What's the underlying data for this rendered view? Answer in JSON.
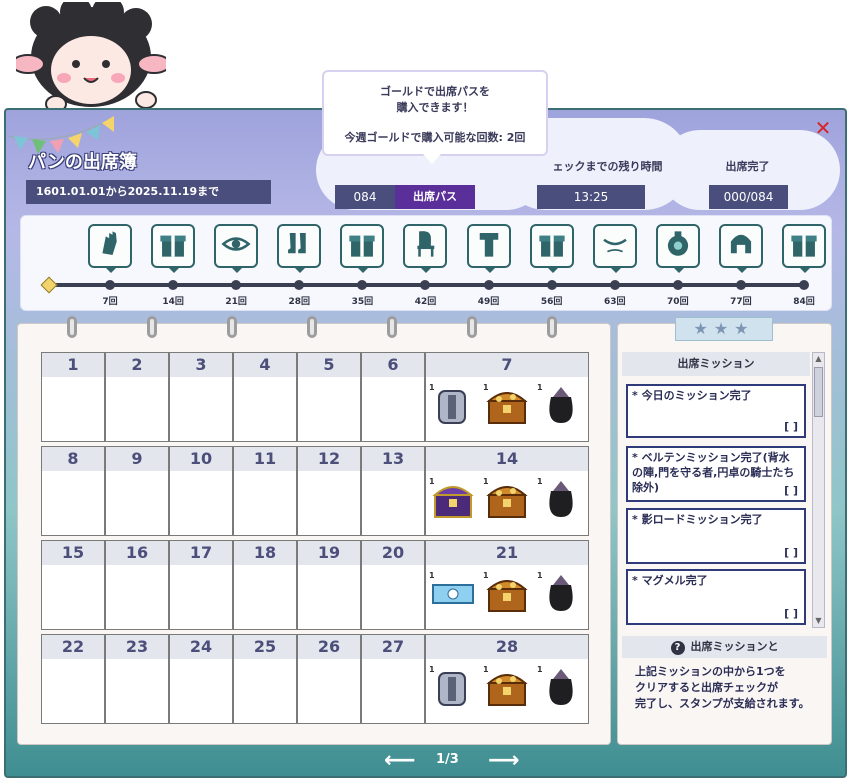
{
  "window": {
    "title": "パンの出席簿",
    "date_range": "1601.01.01から2025.11.19まで"
  },
  "tooltip": {
    "line1": "ゴールドで出席パスを",
    "line2": "購入できます！",
    "line3": "今週ゴールドで購入可能な回数: 2回"
  },
  "pass": {
    "count": "084",
    "button_label": "出席パス"
  },
  "remaining": {
    "label": "ェックまでの残り時間",
    "value": "13:25"
  },
  "completion": {
    "label": "出席完了",
    "value": "000/084"
  },
  "track": {
    "rewards": [
      "glove-icon",
      "gift-box-icon",
      "eye-icon",
      "boots-icon",
      "gift-box-icon",
      "chair-icon",
      "outfit-icon",
      "gift-box-icon",
      "eyebrow-icon",
      "vase-icon",
      "helmet-icon",
      "gift-box-icon"
    ],
    "milestones": [
      "7回",
      "14回",
      "21回",
      "28回",
      "35回",
      "42回",
      "49回",
      "56回",
      "63回",
      "70回",
      "77回",
      "84回"
    ]
  },
  "calendar": {
    "weeks": [
      {
        "days": [
          "1",
          "2",
          "3",
          "4",
          "5",
          "6"
        ],
        "reward_day": "7",
        "items": [
          {
            "icon": "armor-icon",
            "badge": "1"
          },
          {
            "icon": "treasure-chest-icon",
            "badge": "1"
          },
          {
            "icon": "pouch-icon",
            "badge": "1"
          }
        ]
      },
      {
        "days": [
          "8",
          "9",
          "10",
          "11",
          "12",
          "13"
        ],
        "reward_day": "14",
        "items": [
          {
            "icon": "purple-chest-icon",
            "badge": "1"
          },
          {
            "icon": "treasure-chest-icon",
            "badge": "1"
          },
          {
            "icon": "pouch-icon",
            "badge": "1"
          }
        ]
      },
      {
        "days": [
          "15",
          "16",
          "17",
          "18",
          "19",
          "20"
        ],
        "reward_day": "21",
        "items": [
          {
            "icon": "ticket-icon",
            "badge": "1"
          },
          {
            "icon": "treasure-chest-icon",
            "badge": "1"
          },
          {
            "icon": "pouch-icon",
            "badge": "1"
          }
        ]
      },
      {
        "days": [
          "22",
          "23",
          "24",
          "25",
          "26",
          "27"
        ],
        "reward_day": "28",
        "items": [
          {
            "icon": "armor-icon",
            "badge": "1"
          },
          {
            "icon": "treasure-chest-icon",
            "badge": "1"
          },
          {
            "icon": "pouch-icon",
            "badge": "1"
          }
        ]
      }
    ]
  },
  "missions": {
    "header": "出席ミッション",
    "items": [
      {
        "text": "* 今日のミッション完了",
        "check": "[ ]"
      },
      {
        "text": "* ベルテンミッション完了(背水の陣,門を守る者,円卓の騎士たち除外)",
        "check": "[ ]"
      },
      {
        "text": "* 影ロードミッション完了",
        "check": "[ ]"
      },
      {
        "text": "* マグメル完了",
        "check": "[ ]"
      }
    ]
  },
  "help": {
    "title": "出席ミッションと",
    "lines": [
      "上記ミッションの中から1つを",
      "クリアすると出席チェックが",
      "完了し、スタンプが支給されます。"
    ]
  },
  "pagination": {
    "label": "1/3"
  },
  "colors": {
    "accent": "#5b2f9a",
    "window_top": "#9fa3dc",
    "window_bottom": "#3f8e91"
  }
}
